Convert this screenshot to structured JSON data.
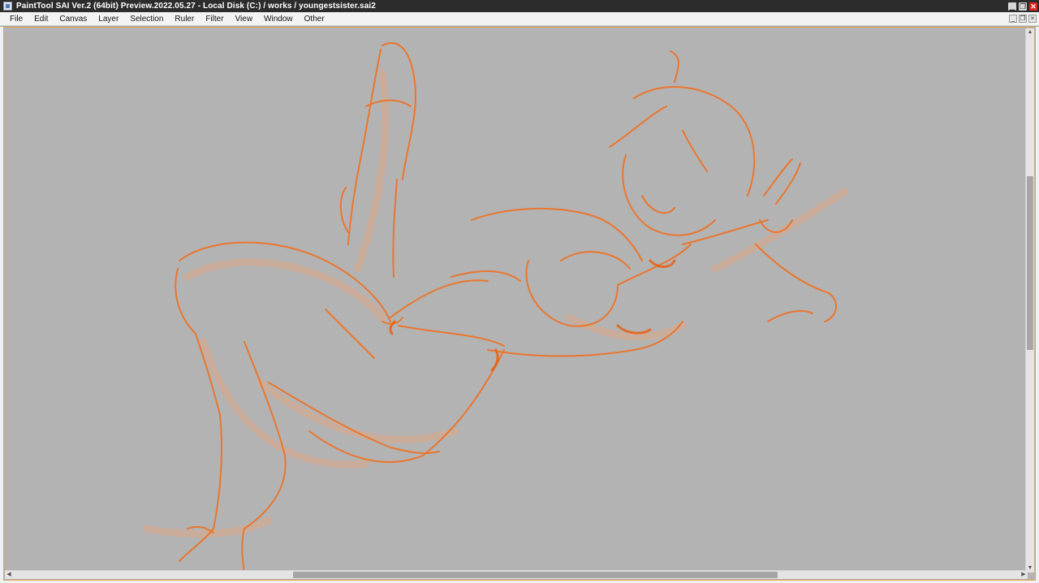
{
  "window": {
    "title": "PaintTool SAI Ver.2 (64bit) Preview.2022.05.27 - Local Disk (C:) / works / youngestsister.sai2",
    "minimize": "▁",
    "restore": "❐",
    "close": "✕"
  },
  "menu": {
    "items": [
      {
        "label": "File"
      },
      {
        "label": "Edit"
      },
      {
        "label": "Canvas"
      },
      {
        "label": "Layer"
      },
      {
        "label": "Selection"
      },
      {
        "label": "Ruler"
      },
      {
        "label": "Filter"
      },
      {
        "label": "View"
      },
      {
        "label": "Window"
      },
      {
        "label": "Other"
      }
    ]
  },
  "mdi": {
    "minimize": "_",
    "restore": "❐",
    "close": "×"
  },
  "scroll": {
    "up": "▲",
    "down": "▼",
    "left": "◀",
    "right": "▶"
  },
  "colors": {
    "sketch_stroke": "#f07020",
    "canvas_bg": "#b3b3b3",
    "titlebar": "#2c2c2c",
    "close_button": "#e0231d"
  }
}
